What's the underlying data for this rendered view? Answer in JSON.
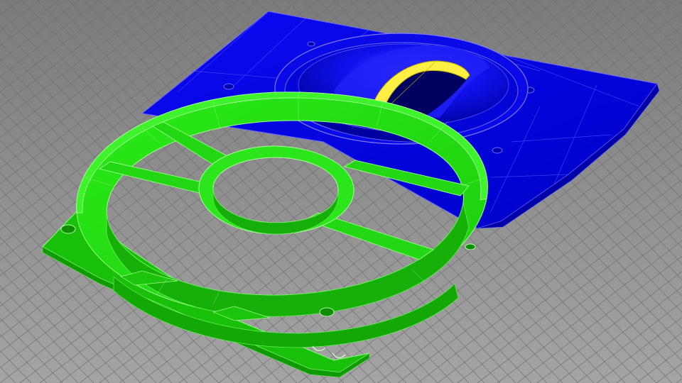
{
  "viewport": {
    "background_top": "#7d7d7d",
    "background_bottom": "#a2a2a2",
    "grid_color": "#6f6f6f"
  },
  "model": {
    "parts": [
      {
        "name": "duct-plate",
        "color": "#0000ee"
      },
      {
        "name": "fan-frame",
        "color": "#22dd10"
      },
      {
        "name": "duct-opening-rim",
        "color": "#ffee44"
      }
    ]
  }
}
